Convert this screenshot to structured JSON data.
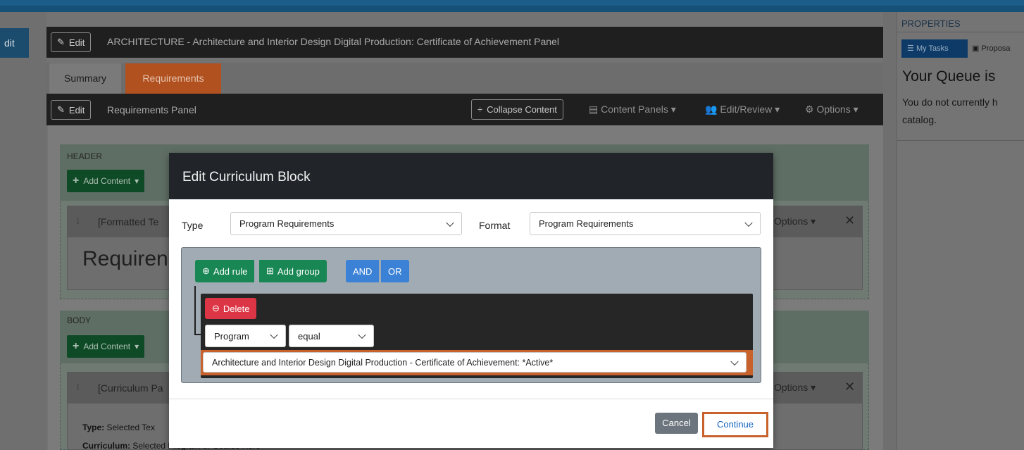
{
  "left_nav": {
    "edit_label": "dit"
  },
  "header": {
    "edit_label": "Edit",
    "title": "ARCHITECTURE - Architecture and Interior Design Digital Production: Certificate of Achievement Panel"
  },
  "tabs": [
    {
      "label": "Summary",
      "active": false
    },
    {
      "label": "Requirements",
      "active": true
    }
  ],
  "panel_bar": {
    "edit_label": "Edit",
    "title": "Requirements Panel",
    "collapse_label": "Collapse Content",
    "content_panels_label": "Content Panels",
    "edit_review_label": "Edit/Review",
    "options_label": "Options"
  },
  "header_section": {
    "label": "HEADER",
    "add_content_label": "Add Content",
    "card_title": "[Formatted Te",
    "card_body": "Requiren",
    "options_label": "Options"
  },
  "body_section": {
    "label": "BODY",
    "add_content_label": "Add Content",
    "card_title": "[Curriculum Pa",
    "options_label": "Options",
    "type_label": "Type:",
    "type_value": "Selected Tex",
    "curriculum_label": "Curriculum:",
    "curriculum_value": "Selected Program or Course Here"
  },
  "properties": {
    "title": "PROPERTIES",
    "tab_my_tasks": "My Tasks",
    "tab_proposals": "Proposa",
    "queue_heading": "Your Queue is",
    "queue_text_1": "You do not currently h",
    "queue_text_2": "catalog."
  },
  "modal": {
    "title": "Edit Curriculum Block",
    "type_label": "Type",
    "type_value": "Program Requirements",
    "format_label": "Format",
    "format_value": "Program Requirements",
    "add_rule_label": "Add rule",
    "add_group_label": "Add group",
    "and_label": "AND",
    "or_label": "OR",
    "delete_label": "Delete",
    "field_value": "Program",
    "operator_value": "equal",
    "program_value": "Architecture and Interior Design Digital Production - Certificate of Achievement: *Active*",
    "cancel_label": "Cancel",
    "continue_label": "Continue"
  },
  "colors": {
    "accent_orange": "#c8612b",
    "green": "#198754",
    "blue": "#3b82d6",
    "red": "#dc3545",
    "link_blue": "#1565c0"
  }
}
